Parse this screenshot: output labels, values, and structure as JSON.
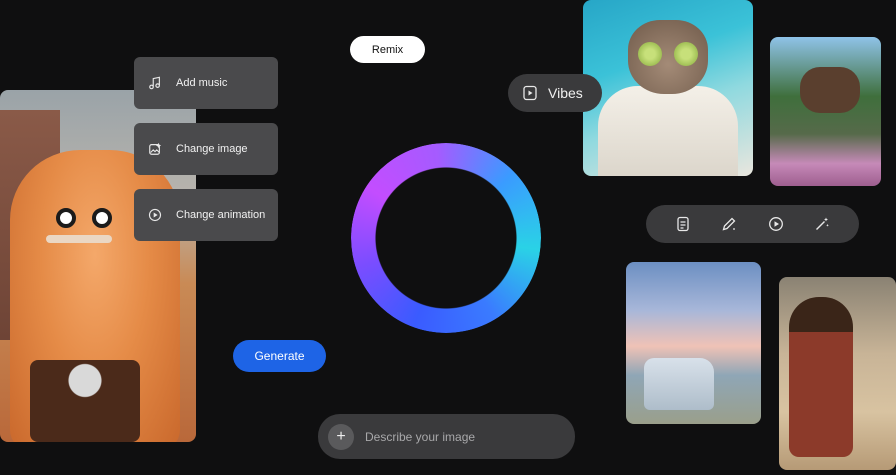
{
  "actions": [
    {
      "label": "Add music",
      "icon": "music-note-icon"
    },
    {
      "label": "Change image",
      "icon": "image-edit-icon"
    },
    {
      "label": "Change animation",
      "icon": "play-circle-icon"
    }
  ],
  "remix": {
    "label": "Remix"
  },
  "vibes": {
    "label": "Vibes",
    "icon": "play-square-icon"
  },
  "toolbar": {
    "icons": [
      "document-icon",
      "pencil-icon",
      "play-circle-icon",
      "magic-wand-icon"
    ]
  },
  "generate": {
    "label": "Generate",
    "color": "#1e64e6"
  },
  "prompt": {
    "placeholder": "Describe your image",
    "value": "",
    "add_icon": "plus-icon"
  },
  "ring": {
    "colors": [
      "#3a5bff",
      "#c34dff",
      "#2ad2e6"
    ]
  },
  "images": [
    "orange-fur-monster-on-motorcycle",
    "cat-with-cucumber-eyes-in-robe",
    "moose-jumping-on-trampoline",
    "white-van-sunset-anime",
    "dancer-in-desert"
  ]
}
